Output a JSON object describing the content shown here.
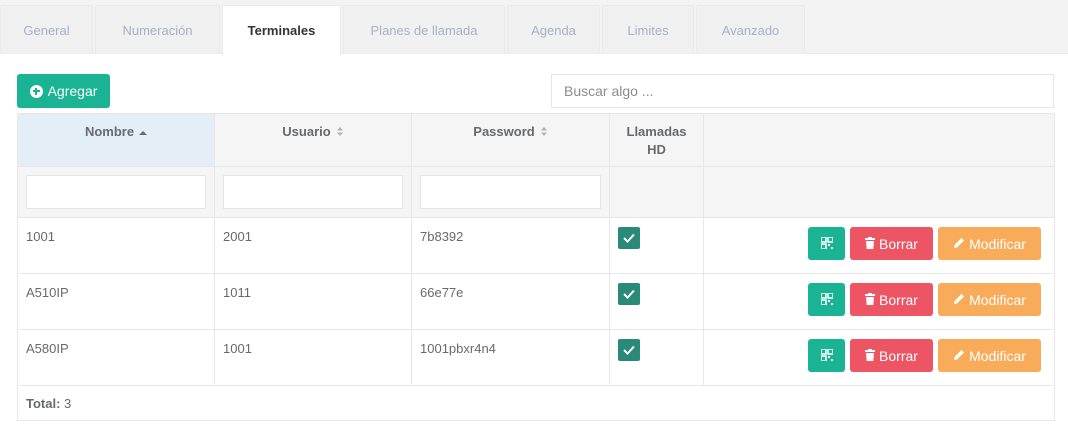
{
  "tabs": [
    {
      "label": "General",
      "active": false
    },
    {
      "label": "Numeración",
      "active": false
    },
    {
      "label": "Terminales",
      "active": true
    },
    {
      "label": "Planes de llamada",
      "active": false
    },
    {
      "label": "Agenda",
      "active": false
    },
    {
      "label": "Limites",
      "active": false
    },
    {
      "label": "Avanzado",
      "active": false
    }
  ],
  "toolbar": {
    "add_label": "Agregar",
    "search_placeholder": "Buscar algo ..."
  },
  "table": {
    "columns": [
      {
        "label": "Nombre",
        "sort": "asc"
      },
      {
        "label": "Usuario",
        "sort": "none"
      },
      {
        "label": "Password",
        "sort": "none"
      },
      {
        "label": "Llamadas HD",
        "sort": null
      }
    ],
    "rows": [
      {
        "nombre": "1001",
        "usuario": "2001",
        "password": "7b8392",
        "llamadas_hd": true
      },
      {
        "nombre": "A510IP",
        "usuario": "1011",
        "password": "66e77e",
        "llamadas_hd": true
      },
      {
        "nombre": "A580IP",
        "usuario": "1001",
        "password": "1001pbxr4n4",
        "llamadas_hd": true
      }
    ],
    "actions": {
      "delete_label": "Borrar",
      "modify_label": "Modificar"
    },
    "footer": {
      "total_label": "Total:",
      "total_value": "3"
    }
  },
  "colors": {
    "primary": "#1ab394",
    "danger": "#ed5565",
    "warning": "#f8ac59",
    "checkbox": "#2a8a78"
  }
}
